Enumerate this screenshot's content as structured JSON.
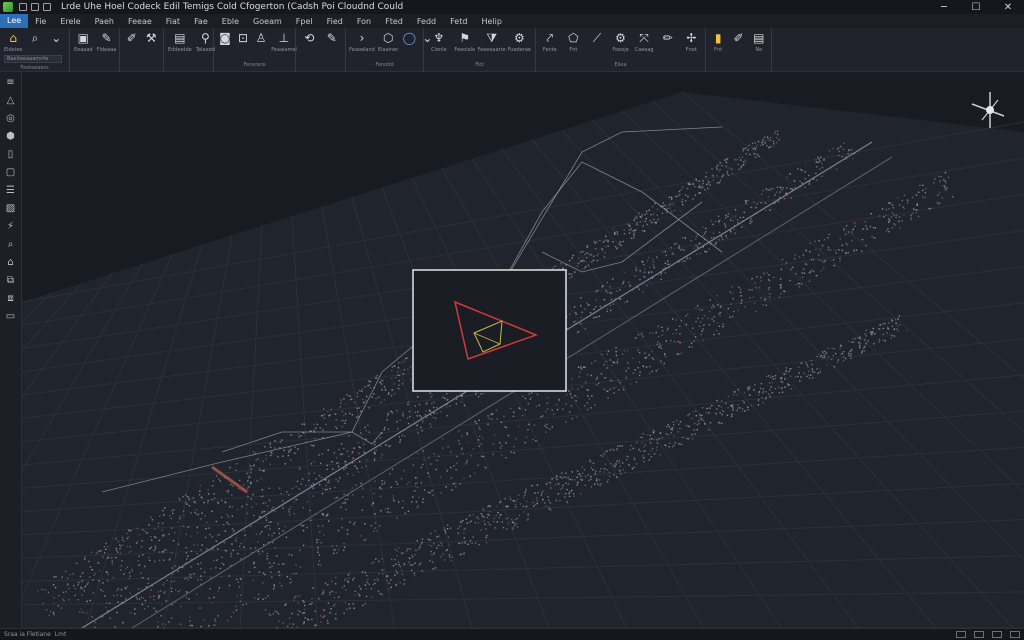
{
  "app": {
    "title": "Lrde Uhe Hoel Codeck Edil Temigs Cold Cfogerton (Cadsh Poi Cloudnd Could",
    "window_controls": {
      "minimize": "─",
      "maximize": "☐",
      "close": "✕"
    }
  },
  "menu": {
    "items": [
      {
        "label": "Lee",
        "active": true
      },
      {
        "label": "Fie",
        "active": false
      },
      {
        "label": "Erele",
        "active": false
      },
      {
        "label": "Paeh",
        "active": false
      },
      {
        "label": "Feeae",
        "active": false
      },
      {
        "label": "Fiat",
        "active": false
      },
      {
        "label": "Fae",
        "active": false
      },
      {
        "label": "Eble",
        "active": false
      },
      {
        "label": "Goeam",
        "active": false
      },
      {
        "label": "Fpel",
        "active": false
      },
      {
        "label": "Fied",
        "active": false
      },
      {
        "label": "Fon",
        "active": false
      },
      {
        "label": "Fted",
        "active": false
      },
      {
        "label": "Fedd",
        "active": false
      },
      {
        "label": "Fetd",
        "active": false
      },
      {
        "label": "Helip",
        "active": false
      }
    ]
  },
  "ribbon": {
    "groups": [
      {
        "label": "Feeteeaess",
        "search_placeholder": "Baeiteeaaamnfe",
        "tools": [
          {
            "icon": "home-icon",
            "glyph": "⌂",
            "label": "Eldeiee",
            "color": "yellow"
          },
          {
            "icon": "search-icon",
            "glyph": "⌕",
            "label": ""
          },
          {
            "icon": "chevron-down-icon",
            "glyph": "⌄",
            "label": ""
          }
        ]
      },
      {
        "label": "",
        "tools": [
          {
            "icon": "save-icon",
            "glyph": "▣",
            "label": "Eeaaad"
          },
          {
            "icon": "brush-icon",
            "glyph": "✎",
            "label": "Fldeaaa"
          }
        ]
      },
      {
        "label": "",
        "tools": [
          {
            "icon": "pen-icon",
            "glyph": "✐",
            "label": ""
          },
          {
            "icon": "wand-icon",
            "glyph": "⚒",
            "label": ""
          }
        ]
      },
      {
        "label": "",
        "tools": [
          {
            "icon": "file-icon",
            "glyph": "▤",
            "label": "Eddeetde"
          },
          {
            "icon": "pin-icon",
            "glyph": "⚲",
            "label": "Telaadd"
          }
        ]
      },
      {
        "label": "Fenerare",
        "tools": [
          {
            "icon": "camera-icon",
            "glyph": "◙",
            "label": ""
          },
          {
            "icon": "lock-icon",
            "glyph": "⊡",
            "label": ""
          },
          {
            "icon": "user-icon",
            "glyph": "♙",
            "label": ""
          },
          {
            "icon": "ruler-icon",
            "glyph": "⊥",
            "label": "Feaaiamel"
          }
        ]
      },
      {
        "label": "",
        "tools": [
          {
            "icon": "lasso-icon",
            "glyph": "⟲",
            "label": ""
          },
          {
            "icon": "edit-icon",
            "glyph": "✎",
            "label": ""
          }
        ]
      },
      {
        "label": "Fenodd",
        "tools": [
          {
            "icon": "arrow-icon",
            "glyph": "›",
            "label": "Feaoeland"
          },
          {
            "icon": "polygon-icon",
            "glyph": "⬡",
            "label": "Eiaainer"
          },
          {
            "icon": "circle-icon",
            "glyph": "◯",
            "label": "",
            "color": "blue"
          },
          {
            "icon": "chevron-down-icon",
            "glyph": "⌄",
            "label": ""
          }
        ]
      },
      {
        "label": "Fiol",
        "tools": [
          {
            "icon": "paint-icon",
            "glyph": "♆",
            "label": "Cienle"
          },
          {
            "icon": "flag-icon",
            "glyph": "⚑",
            "label": "Feeoiale"
          },
          {
            "icon": "filter-icon",
            "glyph": "⧩",
            "label": "Faeeeaarte"
          },
          {
            "icon": "badge-icon",
            "glyph": "⚙",
            "label": "Fuederae"
          }
        ]
      },
      {
        "label": "Eiiea",
        "tools": [
          {
            "icon": "dig-icon",
            "glyph": "⤤",
            "label": "Fente"
          },
          {
            "icon": "shape-icon",
            "glyph": "⬠",
            "label": "Fnt"
          },
          {
            "icon": "tool-icon",
            "glyph": "⟋",
            "label": ""
          },
          {
            "icon": "gear-icon",
            "glyph": "⚙",
            "label": "Feeoje"
          },
          {
            "icon": "move-icon",
            "glyph": "⤧",
            "label": "Caeeag"
          },
          {
            "icon": "pencil-icon",
            "glyph": "✏",
            "label": ""
          },
          {
            "icon": "fan-icon",
            "glyph": "✢",
            "label": "Fnot"
          }
        ]
      },
      {
        "label": "",
        "tools": [
          {
            "icon": "folder-icon",
            "glyph": "▮",
            "label": "Fnt",
            "color": "yellow"
          },
          {
            "icon": "marker-icon",
            "glyph": "✐",
            "label": ""
          },
          {
            "icon": "layers-icon",
            "glyph": "▤",
            "label": "Ne"
          }
        ]
      }
    ]
  },
  "left_toolbar": {
    "tools": [
      {
        "icon": "layers-icon",
        "glyph": "≡"
      },
      {
        "icon": "triangle-icon",
        "glyph": "△"
      },
      {
        "icon": "globe-icon",
        "glyph": "◎"
      },
      {
        "icon": "cube-icon",
        "glyph": "⬢"
      },
      {
        "icon": "page-icon",
        "glyph": "▯"
      },
      {
        "icon": "box-icon",
        "glyph": "▢"
      },
      {
        "icon": "stack-icon",
        "glyph": "☰"
      },
      {
        "icon": "image-icon",
        "glyph": "▨"
      },
      {
        "icon": "bolt-icon",
        "glyph": "⚡"
      },
      {
        "icon": "search-icon",
        "glyph": "⌕"
      },
      {
        "icon": "tag-icon",
        "glyph": "⌂"
      },
      {
        "icon": "copy-icon",
        "glyph": "⧉"
      },
      {
        "icon": "scale-icon",
        "glyph": "⧈"
      },
      {
        "icon": "window-icon",
        "glyph": "▭"
      }
    ]
  },
  "viewport": {
    "background": "#181b21",
    "grid_color": "#2b303a",
    "point_color": "#9aa0aa",
    "accent_point_color": "#c0504d",
    "inset_outline_color": "#d23a3a",
    "inset_inner_color": "#c9b84a",
    "gizmo_label": ""
  },
  "status": {
    "left_text": "Sraa ia Fletiane",
    "sub_text": "Lmt"
  }
}
